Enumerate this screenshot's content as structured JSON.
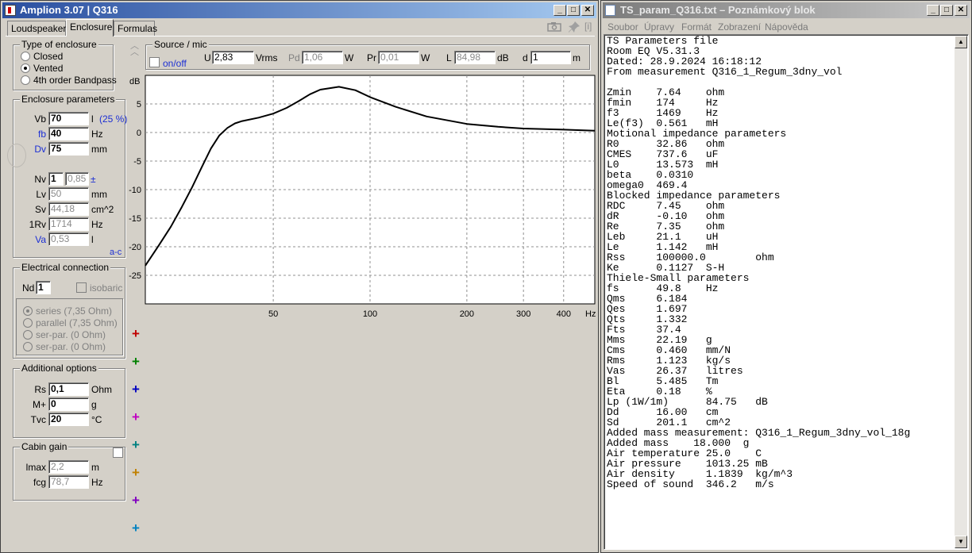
{
  "amplion": {
    "title": "Amplion 3.07  |  Q316",
    "tabs": [
      "Loudspeaker",
      "Enclosure",
      "Formulas"
    ],
    "type_of_enclosure": {
      "title": "Type of enclosure",
      "options": [
        "Closed",
        "Vented",
        "4th order Bandpass"
      ],
      "selected": "Vented"
    },
    "enclosure_parameters": {
      "title": "Enclosure parameters",
      "vb_label": "Vb",
      "vb_value": "70",
      "vb_unit": "l",
      "vb_pct": "(25 %)",
      "fb_label": "fb",
      "fb_value": "40",
      "fb_unit": "Hz",
      "dv_label": "Dv",
      "dv_value": "75",
      "dv_unit": "mm",
      "nv_label": "Nv",
      "nv_value": "1",
      "nv_value2": "0,85",
      "nv_pm": "±",
      "lv_label": "Lv",
      "lv_value": "50",
      "lv_unit": "mm",
      "sv_label": "Sv",
      "sv_value": "44,18",
      "sv_unit": "cm^2",
      "rv_label": "1Rv",
      "rv_value": "1714",
      "rv_unit": "Hz",
      "va_label": "Va",
      "va_value": "0,53",
      "va_unit": "l",
      "ac_label": "a-c"
    },
    "electrical_connection": {
      "title": "Electrical connection",
      "nd_label": "Nd",
      "nd_value": "1",
      "isobaric_label": "isobaric",
      "options": [
        "series (7,35 Ohm)",
        "parallel (7,35 Ohm)",
        "ser-par. (0 Ohm)",
        "ser-par. (0 Ohm)"
      ]
    },
    "additional_options": {
      "title": "Additional options",
      "rs_label": "Rs",
      "rs_value": "0,1",
      "rs_unit": "Ohm",
      "m_label": "M+",
      "m_value": "0",
      "m_unit": "g",
      "tvc_label": "Tvc",
      "tvc_value": "20",
      "tvc_unit": "°C"
    },
    "cabin_gain": {
      "title": "Cabin gain",
      "lmax_label": "lmax",
      "lmax_value": "2,2",
      "lmax_unit": "m",
      "fcg_label": "fcg",
      "fcg_value": "78,7",
      "fcg_unit": "Hz"
    },
    "source_mic": {
      "title": "Source / mic",
      "onoff_label": "on/off",
      "u_label": "U",
      "u_value": "2,83",
      "u_unit": "Vrms",
      "pd_label": "Pd",
      "pd_value": "1,06",
      "pd_unit": "W",
      "pr_label": "Pr",
      "pr_value": "0,01",
      "pr_unit": "W",
      "l_label": "L",
      "l_value": "84,98",
      "l_unit": "dB",
      "d_label": "d",
      "d_value": "1",
      "d_unit": "m"
    },
    "series_add_colors": [
      "#c00000",
      "#008000",
      "#0000c0",
      "#c000c0",
      "#008080",
      "#c08000",
      "#8000c0",
      "#0080c0"
    ]
  },
  "chart_data": {
    "type": "line",
    "ylabel": "dB",
    "xlabel": "Hz",
    "x_scale": "log",
    "xlim": [
      20,
      500
    ],
    "ylim": [
      -30,
      10
    ],
    "x_ticks": [
      50,
      100,
      200,
      300,
      400
    ],
    "x_tick_labels": [
      "50",
      "100",
      "200",
      "300",
      "400"
    ],
    "y_ticks": [
      5,
      0,
      -5,
      -10,
      -15,
      -20,
      -25
    ],
    "y_tick_labels": [
      "5",
      "0",
      "-5",
      "-10",
      "-15",
      "-20",
      "-25"
    ],
    "grid": true,
    "series": [
      {
        "color": "#000000",
        "x": [
          20,
          22,
          24,
          26,
          28,
          30,
          32,
          34,
          36,
          38,
          40,
          45,
          50,
          55,
          60,
          65,
          70,
          80,
          90,
          100,
          120,
          150,
          200,
          250,
          300,
          400,
          500
        ],
        "values": [
          -23.3,
          -19.8,
          -16.5,
          -13.0,
          -9.5,
          -6.0,
          -2.8,
          -0.5,
          0.8,
          1.6,
          2.0,
          2.6,
          3.3,
          4.3,
          5.5,
          6.7,
          7.5,
          8.0,
          7.4,
          6.2,
          4.5,
          2.8,
          1.5,
          1.0,
          0.7,
          0.5,
          0.3
        ]
      }
    ]
  },
  "notepad": {
    "title": "TS_param_Q316.txt – Poznámkový blok",
    "menu": [
      "Soubor",
      "Úpravy",
      "Formát",
      "Zobrazení",
      "Nápověda"
    ],
    "lines": [
      "TS Parameters file",
      "Room EQ V5.31.3",
      "Dated: 28.9.2024 16:18:12",
      "From measurement Q316_1_Regum_3dny_vol",
      "",
      "Zmin    7.64    ohm",
      "fmin    174     Hz",
      "f3      1469    Hz",
      "Le(f3)  0.561   mH",
      "Motional impedance parameters",
      "R0      32.86   ohm",
      "CMES    737.6   uF",
      "L0      13.573  mH",
      "beta    0.0310",
      "omega0  469.4",
      "Blocked impedance parameters",
      "RDC     7.45    ohm",
      "dR      -0.10   ohm",
      "Re      7.35    ohm",
      "Leb     21.1    uH",
      "Le      1.142   mH",
      "Rss     100000.0        ohm",
      "Ke      0.1127  S-H",
      "Thiele-Small parameters",
      "fs      49.8    Hz",
      "Qms     6.184",
      "Qes     1.697",
      "Qts     1.332",
      "Fts     37.4",
      "Mms     22.19   g",
      "Cms     0.460   mm/N",
      "Rms     1.123   kg/s",
      "Vas     26.37   litres",
      "Bl      5.485   Tm",
      "Eta     0.18    %",
      "Lp (1W/1m)      84.75   dB",
      "Dd      16.00   cm",
      "Sd      201.1   cm^2",
      "Added mass measurement: Q316_1_Regum_3dny_vol_18g",
      "Added mass    18.000  g",
      "Air temperature 25.0    C",
      "Air pressure    1013.25 mB",
      "Air density     1.1839  kg/m^3",
      "Speed of sound  346.2   m/s"
    ]
  }
}
